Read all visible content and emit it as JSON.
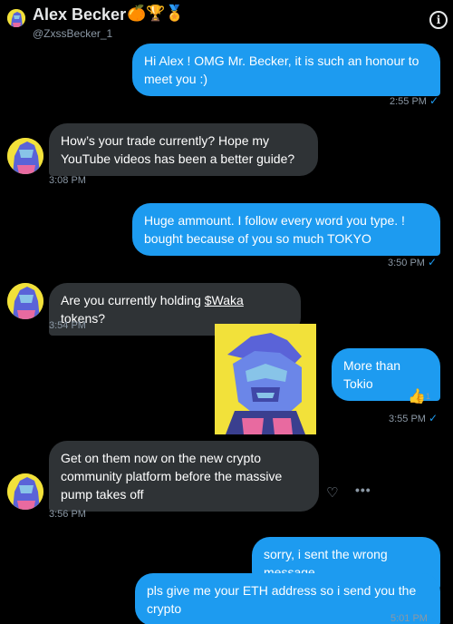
{
  "header": {
    "name": "Alex Becker",
    "emojis": "🍊🏆🏅",
    "handle": "@ZxssBecker_1",
    "info_icon": "info-icon"
  },
  "messages": [
    {
      "dir": "out",
      "text": "Hi Alex ! OMG Mr. Becker, it is such an honour to meet you :)",
      "time": "2:55 PM"
    },
    {
      "dir": "in",
      "text": "How’s your trade currently? Hope my YouTube videos has been a better guide?",
      "time": "3:08 PM"
    },
    {
      "dir": "out",
      "text": "Huge ammount. I follow every word you type. ! bought because of you so much TOKYO",
      "time": "3:50 PM"
    },
    {
      "dir": "in",
      "text_before": "Are you currently holding ",
      "token": "$Waka",
      "text_after": " tokens?",
      "time": "3:54 PM"
    },
    {
      "dir": "out",
      "text": "More than Tokio",
      "reaction": "👍",
      "reaction_count": "1",
      "time": "3:55 PM"
    },
    {
      "dir": "in",
      "text": "Get on them now on the new crypto community platform before the massive pump takes off",
      "time": "3:56 PM"
    },
    {
      "dir": "out",
      "text": "sorry, i sent the wrong message"
    },
    {
      "dir": "out",
      "text": "pls give me your ETH address so i send you the crypto",
      "time": "5:01 PM"
    }
  ],
  "read_receipt": "✓",
  "actions": {
    "react_icon": "heart-plus-icon",
    "more_icon": "more-icon",
    "more_label": "•••",
    "react_label": "♡"
  },
  "colors": {
    "accent": "#1d9bf0",
    "incoming_bubble": "#2f3336",
    "background": "#000000",
    "avatar_bg": "#f2e13a"
  }
}
